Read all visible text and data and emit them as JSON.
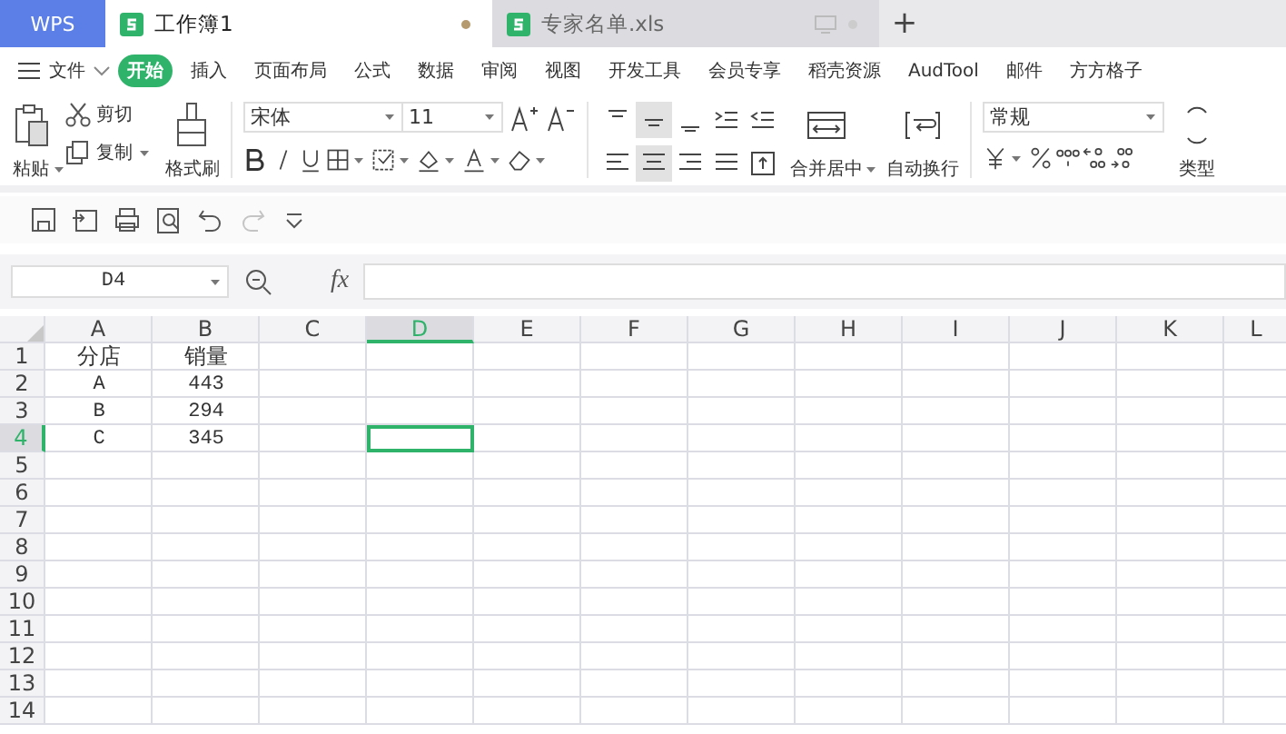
{
  "app_button": "WPS",
  "tabs": [
    {
      "label": "工作簿1",
      "selected": true,
      "modified": true
    },
    {
      "label": "专家名单.xls",
      "selected": false,
      "modified": false
    }
  ],
  "new_tab": "+",
  "menu": {
    "file": "文件",
    "items": [
      {
        "label": "开始",
        "selected": true
      },
      {
        "label": "插入",
        "selected": false
      },
      {
        "label": "页面布局",
        "selected": false
      },
      {
        "label": "公式",
        "selected": false
      },
      {
        "label": "数据",
        "selected": false
      },
      {
        "label": "审阅",
        "selected": false
      },
      {
        "label": "视图",
        "selected": false
      },
      {
        "label": "开发工具",
        "selected": false
      },
      {
        "label": "会员专享",
        "selected": false
      },
      {
        "label": "稻壳资源",
        "selected": false
      },
      {
        "label": "AudTool",
        "selected": false
      },
      {
        "label": "邮件",
        "selected": false
      },
      {
        "label": "方方格子",
        "selected": false
      }
    ]
  },
  "ribbon": {
    "paste": "粘贴",
    "cut": "剪切",
    "copy": "复制",
    "format_painter": "格式刷",
    "font_name": "宋体",
    "font_size": "11",
    "align_buttons": [
      {
        "selected": false
      },
      {
        "selected": true
      },
      {
        "selected": false
      },
      {
        "selected": false
      },
      {
        "selected": false
      },
      {
        "selected": false
      },
      {
        "selected": true
      },
      {
        "selected": false
      },
      {
        "selected": false
      },
      {
        "selected": false
      }
    ],
    "merge": "合并居中",
    "wrap": "自动换行",
    "number_format": "常规",
    "convert": "类型"
  },
  "quick_access": [
    {
      "disabled": false
    },
    {
      "disabled": false
    },
    {
      "disabled": false
    },
    {
      "disabled": false
    },
    {
      "disabled": false
    },
    {
      "disabled": true
    },
    {
      "disabled": false
    }
  ],
  "name_box": "D4",
  "fx": "fx",
  "sheet": {
    "columns": [
      {
        "label": "A",
        "selected": false
      },
      {
        "label": "B",
        "selected": false
      },
      {
        "label": "C",
        "selected": false
      },
      {
        "label": "D",
        "selected": true
      },
      {
        "label": "E",
        "selected": false
      },
      {
        "label": "F",
        "selected": false
      },
      {
        "label": "G",
        "selected": false
      },
      {
        "label": "H",
        "selected": false
      },
      {
        "label": "I",
        "selected": false
      },
      {
        "label": "J",
        "selected": false
      },
      {
        "label": "K",
        "selected": false
      },
      {
        "label": "L",
        "selected": false
      }
    ],
    "rows": [
      {
        "label": "1",
        "selected": false,
        "cells": [
          "分店",
          "销量"
        ]
      },
      {
        "label": "2",
        "selected": false,
        "cells": [
          "A",
          "443"
        ]
      },
      {
        "label": "3",
        "selected": false,
        "cells": [
          "B",
          "294"
        ]
      },
      {
        "label": "4",
        "selected": true,
        "cells": [
          "C",
          "345"
        ]
      },
      {
        "label": "5",
        "selected": false,
        "cells": []
      },
      {
        "label": "6",
        "selected": false,
        "cells": []
      },
      {
        "label": "7",
        "selected": false,
        "cells": []
      },
      {
        "label": "8",
        "selected": false,
        "cells": []
      },
      {
        "label": "9",
        "selected": false,
        "cells": []
      },
      {
        "label": "10",
        "selected": false,
        "cells": []
      },
      {
        "label": "11",
        "selected": false,
        "cells": []
      },
      {
        "label": "12",
        "selected": false,
        "cells": []
      },
      {
        "label": "13",
        "selected": false,
        "cells": []
      },
      {
        "label": "14",
        "selected": false,
        "cells": []
      }
    ]
  }
}
